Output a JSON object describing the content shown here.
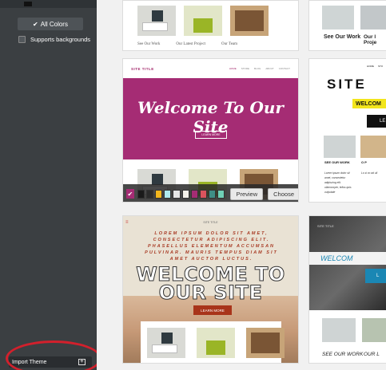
{
  "sidebar": {
    "all_colors_label": "All Colors",
    "supports_backgrounds_label": "Supports backgrounds",
    "import_theme_label": "Import Theme"
  },
  "themes": {
    "row0": {
      "card_a": {
        "captions": [
          "See Our Work",
          "Our Latest Project",
          "Our Team"
        ]
      },
      "card_b": {
        "label1": "See Our Work",
        "label2a": "Our l",
        "label2b": "Proje"
      }
    },
    "pink": {
      "site_title": "SITE TITLE",
      "nav": [
        "HOME",
        "STORE",
        "BLOG",
        "ABOUT",
        "CONTACT"
      ],
      "welcome": "Welcome To Our Site",
      "learn_more": "LEARN MORE",
      "swatches": [
        "#1a1a1a",
        "#2b2b2b",
        "#f2b51c",
        "#aeeaf0",
        "#e6e6e6",
        "#f4f1ea",
        "#a52c74",
        "#d9535d",
        "#3f8f86",
        "#6fd1b5"
      ],
      "preview_label": "Preview",
      "choose_label": "Choose"
    },
    "yellow": {
      "nav": [
        "HOME",
        "STO"
      ],
      "title": "SITE",
      "welcome": "WELCOM",
      "btn": "LE",
      "see_our_work": "SEE OUR WORK",
      "col2_head": "O P",
      "lorem": "Lorem ipsum dolor sit amet, consectetur adipiscing elit. ullamcorper, tellus quis vulputate",
      "lorem2": "Lo si co ad ull"
    },
    "retro": {
      "site_title": "SITE TITLE",
      "lorem": "LOREM IPSUM DOLOR SIT AMET, CONSECTETUR ADIPISCING ELIT. PHASELLUS ELEMENTUM ACCUMSAN PULVINAR. MAURIS TEMPUS DIAM SIT AMET AUCTOR LUCTUS.",
      "welcome_line1": "WELCOME TO",
      "welcome_line2": "OUR SITE",
      "learn_more": "LEARN MORE"
    },
    "dark": {
      "site_title": "SITE TITLE",
      "welcome": "WELCOM",
      "btn": "L",
      "see_our_work": "SEE OUR WORK",
      "col2": "OUR L"
    }
  }
}
